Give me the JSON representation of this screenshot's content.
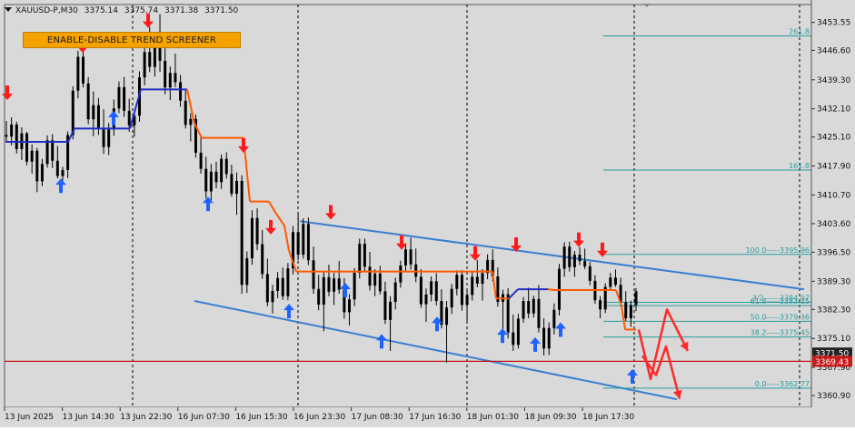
{
  "header": {
    "symbol": "XAUUSD-P,M30",
    "open": "3375.14",
    "high": "3375.74",
    "low": "3371.38",
    "close": "3371.50"
  },
  "screener_button": {
    "label": "ENABLE-DISABLE TREND SCREENER"
  },
  "colors": {
    "background": "#d9d9d9",
    "candle": "#000000",
    "trend_blue": "#1f2fc4",
    "trend_orange": "#ff5a00",
    "arrow_up": "#1e63ff",
    "arrow_down": "#ff1a1a",
    "channel": "#3a7fd0",
    "fib": "#2a9d9d",
    "hline": "#c01818",
    "projection": "#ff2a2a",
    "price_tag": "#c81818",
    "ask_tag": "#222222"
  },
  "chart_data": {
    "type": "candlestick",
    "price_axis": {
      "ylim": [
        3358.9,
        3456.4
      ],
      "ticks": [
        "3453.55",
        "3446.60",
        "3439.30",
        "3432.10",
        "3425.10",
        "3417.90",
        "3410.70",
        "3403.60",
        "3396.50",
        "3389.30",
        "3382.30",
        "3375.10",
        "3367.90",
        "3360.90"
      ]
    },
    "time_axis": {
      "labels": [
        "13 Jun 2025",
        "13 Jun 14:30",
        "13 Jun 22:30",
        "16 Jun 07:30",
        "16 Jun 15:30",
        "16 Jun 23:30",
        "17 Jun 08:30",
        "17 Jun 16:30",
        "18 Jun 01:30",
        "18 Jun 09:30",
        "18 Jun 17:30"
      ]
    },
    "fib_levels": [
      {
        "label": "261.8",
        "price": 3450.2
      },
      {
        "label": "161.8",
        "price": 3416.9
      },
      {
        "label": "100.0-----3395.96",
        "price": 3395.96
      },
      {
        "label": "3/2------3384.07",
        "price": 3384.07
      },
      {
        "label": "61.8-----3383.25",
        "price": 3383.25
      },
      {
        "label": "50.0-----3379.36",
        "price": 3379.36
      },
      {
        "label": "38.2-----3375.45",
        "price": 3375.45
      },
      {
        "label": "0.0-----3362.77",
        "price": 3362.77
      }
    ],
    "horizontal_line": {
      "price": 3369.43
    },
    "price_tags": [
      {
        "label": "3371.50",
        "price": 3371.5,
        "kind": "ask"
      },
      {
        "label": "3369.43",
        "price": 3369.43,
        "kind": "line"
      }
    ],
    "channel": {
      "upper": {
        "from": {
          "x": 330,
          "price": 3404.2
        },
        "to": {
          "x": 885,
          "price": 3387.3
        }
      },
      "lower": {
        "from": {
          "x": 214,
          "price": 3384.4
        },
        "to": {
          "x": 745,
          "price": 3360.0
        }
      }
    },
    "trend_line": [
      {
        "x": 6,
        "price": 3423.9,
        "c": "blue"
      },
      {
        "x": 75,
        "price": 3423.9,
        "c": "blue"
      },
      {
        "x": 82,
        "price": 3427.2,
        "c": "blue"
      },
      {
        "x": 143,
        "price": 3427.2,
        "c": "blue"
      },
      {
        "x": 155,
        "price": 3436.9,
        "c": "blue"
      },
      {
        "x": 206,
        "price": 3436.9,
        "c": "blue"
      },
      {
        "x": 214,
        "price": 3428.5,
        "c": "orange"
      },
      {
        "x": 222,
        "price": 3424.9,
        "c": "orange"
      },
      {
        "x": 268,
        "price": 3424.9,
        "c": "orange"
      },
      {
        "x": 275,
        "price": 3409.1,
        "c": "orange"
      },
      {
        "x": 296,
        "price": 3409.1,
        "c": "orange"
      },
      {
        "x": 303,
        "price": 3406.4,
        "c": "orange"
      },
      {
        "x": 313,
        "price": 3403.1,
        "c": "orange"
      },
      {
        "x": 318,
        "price": 3396.9,
        "c": "orange"
      },
      {
        "x": 326,
        "price": 3391.7,
        "c": "orange"
      },
      {
        "x": 542,
        "price": 3391.7,
        "c": "orange"
      },
      {
        "x": 546,
        "price": 3385.0,
        "c": "orange"
      },
      {
        "x": 560,
        "price": 3385.0,
        "c": "orange"
      },
      {
        "x": 570,
        "price": 3387.3,
        "c": "blue"
      },
      {
        "x": 603,
        "price": 3387.3,
        "c": "blue"
      },
      {
        "x": 610,
        "price": 3387.1,
        "c": "orange"
      },
      {
        "x": 678,
        "price": 3387.1,
        "c": "orange"
      },
      {
        "x": 684,
        "price": 3383.2,
        "c": "orange"
      },
      {
        "x": 688,
        "price": 3377.3,
        "c": "orange"
      },
      {
        "x": 700,
        "price": 3377.3,
        "c": "orange"
      }
    ],
    "down_arrows": [
      {
        "x": 8,
        "price": 3436.1
      },
      {
        "x": 91,
        "price": 3447.8
      },
      {
        "x": 163,
        "price": 3454.0
      },
      {
        "x": 268,
        "price": 3423.0
      },
      {
        "x": 298,
        "price": 3402.7
      },
      {
        "x": 364,
        "price": 3406.4
      },
      {
        "x": 442,
        "price": 3398.9
      },
      {
        "x": 523,
        "price": 3396.2
      },
      {
        "x": 568,
        "price": 3398.4
      },
      {
        "x": 637,
        "price": 3399.6
      },
      {
        "x": 663,
        "price": 3397.1
      }
    ],
    "up_arrows": [
      {
        "x": 67,
        "price": 3413.0
      },
      {
        "x": 125,
        "price": 3429.8
      },
      {
        "x": 229,
        "price": 3408.5
      },
      {
        "x": 318,
        "price": 3381.9
      },
      {
        "x": 380,
        "price": 3387.1
      },
      {
        "x": 420,
        "price": 3374.4
      },
      {
        "x": 481,
        "price": 3378.7
      },
      {
        "x": 553,
        "price": 3375.8
      },
      {
        "x": 589,
        "price": 3373.6
      },
      {
        "x": 617,
        "price": 3377.3
      },
      {
        "x": 696,
        "price": 3365.7
      }
    ],
    "projection_path": [
      {
        "x": 703,
        "price": 3377.3
      },
      {
        "x": 716,
        "price": 3365.0
      },
      {
        "x": 734,
        "price": 3382.3
      },
      {
        "x": 757,
        "price": 3372.0
      }
    ],
    "projection_path_2": [
      {
        "x": 707,
        "price": 3370.8
      },
      {
        "x": 722,
        "price": 3366.0
      },
      {
        "x": 733,
        "price": 3373.1
      },
      {
        "x": 748,
        "price": 3360.1
      }
    ],
    "candles": [
      [
        3425.6,
        3429.1,
        3423.9,
        3425.2
      ],
      [
        3425.2,
        3430.0,
        3423.0,
        3428.2
      ],
      [
        3428.2,
        3428.9,
        3421.0,
        3422.1
      ],
      [
        3422.1,
        3427.5,
        3419.4,
        3426.0
      ],
      [
        3426.0,
        3426.4,
        3418.1,
        3419.0
      ],
      [
        3419.0,
        3423.3,
        3416.0,
        3421.7
      ],
      [
        3421.7,
        3422.4,
        3411.4,
        3414.1
      ],
      [
        3414.1,
        3419.7,
        3412.9,
        3418.4
      ],
      [
        3418.4,
        3425.5,
        3417.5,
        3424.3
      ],
      [
        3424.3,
        3425.8,
        3417.4,
        3419.2
      ],
      [
        3419.2,
        3422.9,
        3414.8,
        3415.4
      ],
      [
        3415.4,
        3417.7,
        3413.2,
        3416.9
      ],
      [
        3416.9,
        3426.5,
        3414.9,
        3425.6
      ],
      [
        3425.6,
        3437.7,
        3424.5,
        3436.6
      ],
      [
        3436.6,
        3446.5,
        3434.7,
        3445.0
      ],
      [
        3445.0,
        3446.5,
        3437.4,
        3438.4
      ],
      [
        3438.4,
        3440.0,
        3428.3,
        3429.5
      ],
      [
        3429.5,
        3436.4,
        3425.3,
        3433.0
      ],
      [
        3433.0,
        3434.8,
        3425.6,
        3427.3
      ],
      [
        3427.3,
        3432.0,
        3420.9,
        3422.6
      ],
      [
        3422.6,
        3428.6,
        3420.6,
        3427.0
      ],
      [
        3427.0,
        3434.4,
        3425.4,
        3432.2
      ],
      [
        3432.2,
        3438.9,
        3431.0,
        3437.5
      ],
      [
        3437.5,
        3440.0,
        3430.1,
        3431.6
      ],
      [
        3431.6,
        3434.6,
        3426.4,
        3428.0
      ],
      [
        3428.0,
        3431.5,
        3425.2,
        3430.4
      ],
      [
        3430.4,
        3441.4,
        3428.9,
        3439.9
      ],
      [
        3439.9,
        3447.5,
        3437.9,
        3446.2
      ],
      [
        3446.2,
        3452.5,
        3441.2,
        3442.5
      ],
      [
        3442.5,
        3450.5,
        3440.1,
        3449.3
      ],
      [
        3449.3,
        3455.6,
        3441.3,
        3444.0
      ],
      [
        3444.0,
        3448.9,
        3435.7,
        3437.4
      ],
      [
        3437.4,
        3442.6,
        3434.3,
        3441.0
      ],
      [
        3441.0,
        3445.8,
        3437.5,
        3438.7
      ],
      [
        3438.7,
        3440.5,
        3432.6,
        3434.1
      ],
      [
        3434.1,
        3436.7,
        3427.2,
        3428.1
      ],
      [
        3428.1,
        3431.0,
        3424.0,
        3429.6
      ],
      [
        3429.6,
        3430.7,
        3420.0,
        3421.2
      ],
      [
        3421.2,
        3425.7,
        3416.0,
        3417.2
      ],
      [
        3417.2,
        3420.2,
        3409.9,
        3411.6
      ],
      [
        3411.6,
        3418.4,
        3409.4,
        3416.5
      ],
      [
        3416.5,
        3419.0,
        3412.4,
        3413.9
      ],
      [
        3413.9,
        3420.8,
        3412.2,
        3419.7
      ],
      [
        3419.7,
        3421.3,
        3414.8,
        3415.9
      ],
      [
        3415.9,
        3418.2,
        3410.3,
        3411.0
      ],
      [
        3411.0,
        3416.3,
        3405.8,
        3414.2
      ],
      [
        3414.2,
        3415.6,
        3386.2,
        3388.4
      ],
      [
        3388.4,
        3396.7,
        3386.4,
        3395.0
      ],
      [
        3395.0,
        3406.9,
        3393.4,
        3405.0
      ],
      [
        3405.0,
        3407.4,
        3397.0,
        3398.5
      ],
      [
        3398.5,
        3402.0,
        3389.9,
        3391.1
      ],
      [
        3391.1,
        3394.9,
        3383.1,
        3384.1
      ],
      [
        3384.1,
        3388.4,
        3381.3,
        3386.9
      ],
      [
        3386.9,
        3391.6,
        3385.1,
        3390.1
      ],
      [
        3390.1,
        3392.7,
        3384.7,
        3385.6
      ],
      [
        3385.6,
        3393.8,
        3384.6,
        3392.5
      ],
      [
        3392.5,
        3403.0,
        3391.0,
        3401.5
      ],
      [
        3401.5,
        3406.0,
        3394.5,
        3395.9
      ],
      [
        3395.9,
        3404.9,
        3394.9,
        3403.5
      ],
      [
        3403.5,
        3405.1,
        3393.3,
        3394.5
      ],
      [
        3394.5,
        3397.9,
        3386.2,
        3387.4
      ],
      [
        3387.4,
        3390.9,
        3382.1,
        3383.5
      ],
      [
        3383.5,
        3391.6,
        3376.9,
        3390.3
      ],
      [
        3390.3,
        3393.4,
        3385.6,
        3386.7
      ],
      [
        3386.7,
        3391.4,
        3383.4,
        3390.0
      ],
      [
        3390.0,
        3394.3,
        3386.2,
        3387.2
      ],
      [
        3387.2,
        3390.1,
        3380.0,
        3381.6
      ],
      [
        3381.6,
        3386.1,
        3378.3,
        3384.8
      ],
      [
        3384.8,
        3392.6,
        3383.1,
        3391.4
      ],
      [
        3391.4,
        3399.9,
        3390.0,
        3398.6
      ],
      [
        3398.6,
        3399.9,
        3391.7,
        3392.9
      ],
      [
        3392.9,
        3396.6,
        3387.0,
        3388.2
      ],
      [
        3388.2,
        3392.3,
        3385.6,
        3391.2
      ],
      [
        3391.2,
        3393.1,
        3386.0,
        3386.8
      ],
      [
        3386.8,
        3389.2,
        3378.7,
        3379.7
      ],
      [
        3379.7,
        3385.6,
        3372.0,
        3384.2
      ],
      [
        3384.2,
        3390.2,
        3382.3,
        3389.0
      ],
      [
        3389.0,
        3394.4,
        3387.7,
        3393.2
      ],
      [
        3393.2,
        3398.3,
        3391.8,
        3397.2
      ],
      [
        3397.2,
        3400.1,
        3392.2,
        3393.5
      ],
      [
        3393.5,
        3397.4,
        3389.1,
        3390.4
      ],
      [
        3390.4,
        3392.3,
        3382.7,
        3383.6
      ],
      [
        3383.6,
        3387.5,
        3379.2,
        3386.0
      ],
      [
        3386.0,
        3390.5,
        3384.3,
        3389.3
      ],
      [
        3389.3,
        3391.3,
        3383.3,
        3384.4
      ],
      [
        3384.4,
        3387.3,
        3377.6,
        3378.5
      ],
      [
        3378.5,
        3384.4,
        3369.1,
        3382.8
      ],
      [
        3382.8,
        3388.6,
        3381.2,
        3387.4
      ],
      [
        3387.4,
        3392.0,
        3385.8,
        3390.9
      ],
      [
        3390.9,
        3392.0,
        3382.0,
        3383.4
      ],
      [
        3383.4,
        3387.1,
        3379.4,
        3385.9
      ],
      [
        3385.9,
        3391.7,
        3384.5,
        3390.4
      ],
      [
        3390.4,
        3394.6,
        3387.8,
        3388.7
      ],
      [
        3388.7,
        3392.3,
        3384.5,
        3391.3
      ],
      [
        3391.3,
        3396.0,
        3389.8,
        3394.6
      ],
      [
        3394.6,
        3397.2,
        3389.3,
        3390.5
      ],
      [
        3390.5,
        3392.7,
        3383.0,
        3384.2
      ],
      [
        3384.2,
        3387.2,
        3377.5,
        3386.1
      ],
      [
        3386.1,
        3387.6,
        3375.1,
        3376.6
      ],
      [
        3376.6,
        3381.0,
        3372.0,
        3373.5
      ],
      [
        3373.5,
        3381.2,
        3372.6,
        3380.0
      ],
      [
        3380.0,
        3385.4,
        3379.0,
        3384.4
      ],
      [
        3384.4,
        3387.7,
        3380.1,
        3381.3
      ],
      [
        3381.3,
        3385.7,
        3380.3,
        3384.9
      ],
      [
        3384.9,
        3388.4,
        3376.6,
        3377.7
      ],
      [
        3377.7,
        3380.1,
        3370.9,
        3372.6
      ],
      [
        3372.6,
        3379.1,
        3371.0,
        3377.7
      ],
      [
        3377.7,
        3383.8,
        3376.1,
        3382.2
      ],
      [
        3382.2,
        3393.6,
        3380.8,
        3392.4
      ],
      [
        3392.4,
        3399.0,
        3390.4,
        3397.9
      ],
      [
        3397.9,
        3399.1,
        3391.7,
        3392.8
      ],
      [
        3392.8,
        3396.8,
        3390.4,
        3395.9
      ],
      [
        3395.9,
        3397.8,
        3393.3,
        3394.3
      ],
      [
        3394.3,
        3397.4,
        3392.3,
        3393.0
      ],
      [
        3393.0,
        3394.1,
        3388.3,
        3389.4
      ],
      [
        3389.4,
        3390.8,
        3383.7,
        3384.6
      ],
      [
        3384.6,
        3385.6,
        3380.1,
        3382.3
      ],
      [
        3382.3,
        3388.8,
        3381.4,
        3387.9
      ],
      [
        3387.9,
        3391.4,
        3386.9,
        3390.2
      ],
      [
        3390.2,
        3392.2,
        3387.9,
        3388.4
      ],
      [
        3388.4,
        3390.2,
        3383.2,
        3384.1
      ],
      [
        3384.1,
        3386.8,
        3379.4,
        3380.1
      ],
      [
        3380.1,
        3384.5,
        3378.0,
        3383.4
      ],
      [
        3383.4,
        3387.6,
        3381.9,
        3386.8
      ]
    ]
  }
}
